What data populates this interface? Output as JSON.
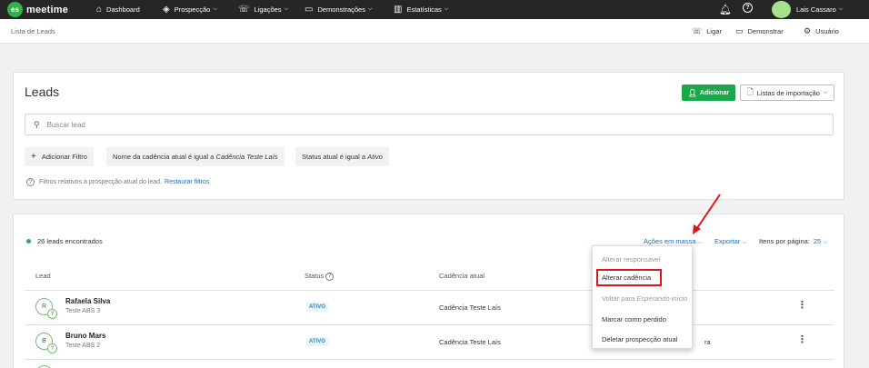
{
  "brand": {
    "mark": "es",
    "name": "meetime"
  },
  "nav": [
    {
      "icon": "home-icon",
      "glyph": "⌂",
      "label": "Dashboard",
      "chev": false
    },
    {
      "icon": "target-icon",
      "glyph": "◈",
      "label": "Prospecção",
      "chev": true
    },
    {
      "icon": "phone-icon",
      "glyph": "☏",
      "label": "Ligações",
      "chev": true
    },
    {
      "icon": "monitor-icon",
      "glyph": "▭",
      "label": "Demonstrações",
      "chev": true
    },
    {
      "icon": "chart-icon",
      "glyph": "▥",
      "label": "Estatísticas",
      "chev": true
    }
  ],
  "user": {
    "name": "Lais Cassaro"
  },
  "subbar": {
    "breadcrumb": "Lista de Leads",
    "call": "Ligar",
    "demo": "Demonstrar",
    "user": "Usuário"
  },
  "leads_card": {
    "title": "Leads",
    "add_button": "Adicionar",
    "import_button": "Listas de importação",
    "search_placeholder": "Buscar lead",
    "filters": {
      "add": "Adicionar Filtro",
      "cadence_prefix": "Nome da cadência atual é igual a ",
      "cadence_value": "Cadência Teste Laís",
      "status_prefix": "Status atual é igual a ",
      "status_value": "Ativo"
    },
    "hint": "Filtros relativos à prospecção atual do lead.",
    "restore": "Restaurar filtros"
  },
  "results": {
    "count": "26 leads encontrados",
    "bulk_actions": "Ações em massa",
    "export": "Exportar",
    "per_page_label": "Itens por página:",
    "per_page_value": "25",
    "columns": {
      "lead": "Lead",
      "status": "Status",
      "cadence": "Cadência atual"
    },
    "rows": [
      {
        "initial": "R",
        "name": "Rafaela Silva",
        "sub": "Teste ABS 3",
        "status": "ATIVO",
        "cadence": "Cadência Teste Laís",
        "extra": ""
      },
      {
        "initial": "B",
        "name": "Bruno Mars",
        "sub": "Teste ABS 2",
        "status": "ATIVO",
        "cadence": "Cadência Teste Laís",
        "extra": "ra"
      }
    ]
  },
  "bulk_menu": {
    "items": [
      {
        "label": "Alterar responsável",
        "disabled": true
      },
      {
        "label": "Alterar cadência",
        "disabled": false,
        "highlighted": true
      },
      {
        "label_prefix": "Voltar para ",
        "label_em": "Esperando início",
        "disabled": true
      },
      {
        "label": "Marcar como perdido",
        "disabled": false
      },
      {
        "label": "Deletar prospecção atual",
        "disabled": false
      }
    ]
  },
  "colors": {
    "brand_green": "#2db34a",
    "add_green": "#1aa84a",
    "link_blue": "#1a6fc2",
    "highlight_red": "#e0141a"
  }
}
